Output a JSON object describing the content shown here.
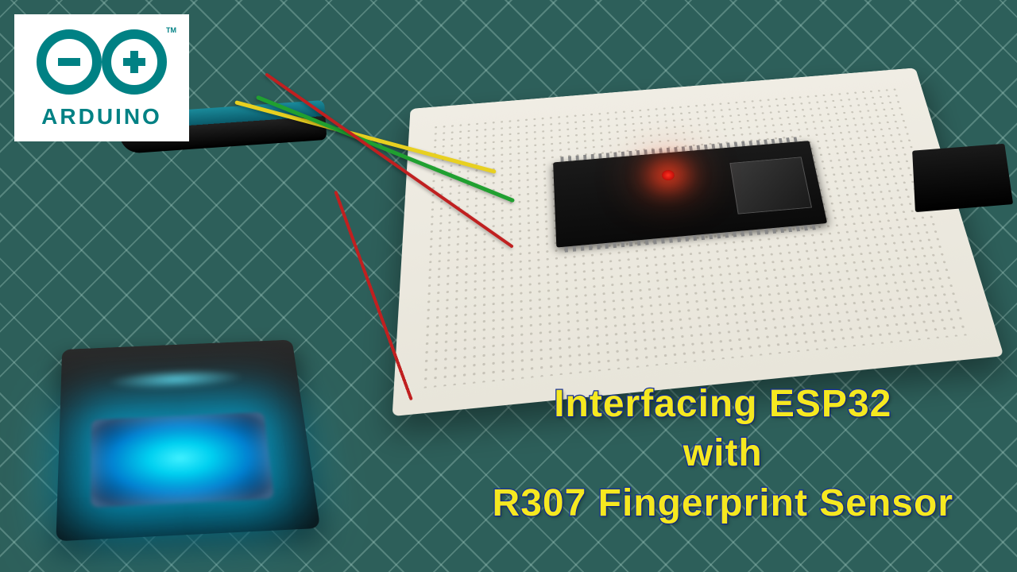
{
  "logo": {
    "brand": "ARDUINO",
    "trademark": "TM"
  },
  "title": {
    "line1": "Interfacing ESP32",
    "line2": "with",
    "line3": "R307 Fingerprint Sensor"
  },
  "components": {
    "microcontroller": "ESP32",
    "sensor": "R307 Fingerprint Sensor",
    "platform": "Arduino",
    "breadboard": "breadboard",
    "led_status": "on",
    "sensor_light": "blue"
  }
}
